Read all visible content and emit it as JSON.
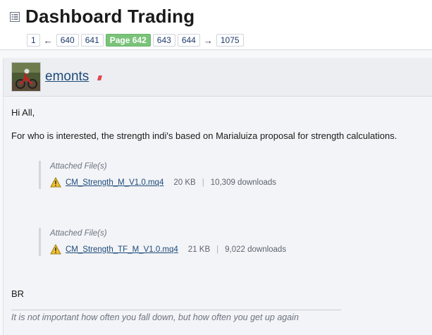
{
  "header": {
    "title": "Dashboard Trading",
    "title_icon": "list-icon"
  },
  "pagination": {
    "first": "1",
    "prev_arrow": "←",
    "pages_before": [
      "640",
      "641"
    ],
    "current": "Page 642",
    "pages_after": [
      "643",
      "644"
    ],
    "next_arrow": "→",
    "last": "1075"
  },
  "post": {
    "username": "emonts",
    "avatar_icon": "motocross-avatar",
    "greeting": "Hi All,",
    "message": "For who is interested, the strength indi's based on Marialuiza proposal for strength calculations.",
    "attachments": [
      {
        "label": "Attached File(s)",
        "icon": "warning-icon",
        "filename": "CM_Strength_M_V1.0.mq4",
        "size": "20 KB",
        "separator": "|",
        "downloads": "10,309 downloads"
      },
      {
        "label": "Attached File(s)",
        "icon": "warning-icon",
        "filename": "CM_Strength_TF_M_V1.0.mq4",
        "size": "21 KB",
        "separator": "|",
        "downloads": "9,022 downloads"
      }
    ],
    "closing": "BR",
    "signature": "It is not important how often you fall down, but how often you get up again"
  },
  "colors": {
    "current_page": "#7ac37a",
    "link": "#1d4a7a",
    "status_dot": "#e0474c"
  }
}
